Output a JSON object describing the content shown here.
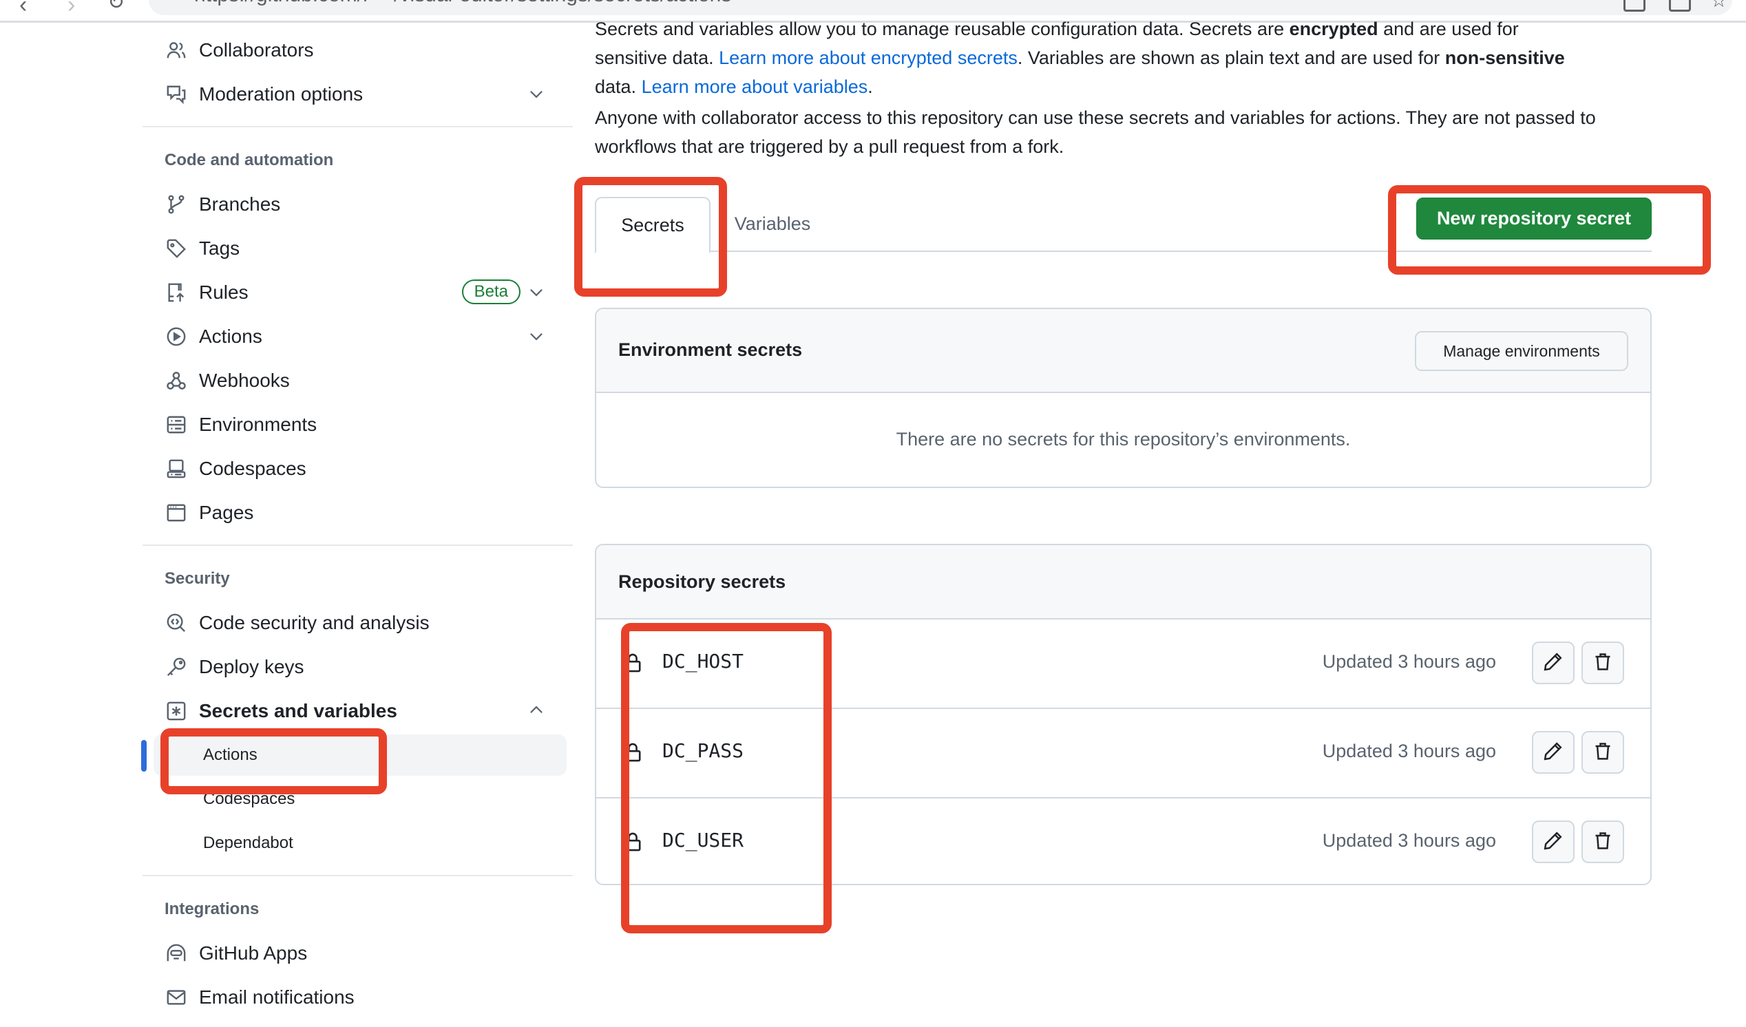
{
  "browser": {
    "url": "https://github.com/r***/visual-editor/settings/secrets/actions"
  },
  "sidebar": {
    "top_items": [
      {
        "label": "Collaborators",
        "icon": "people-icon"
      },
      {
        "label": "Moderation options",
        "icon": "comment-discussion-icon",
        "expandable": true
      }
    ],
    "sections": [
      {
        "heading": "Code and automation",
        "items": [
          {
            "label": "Branches",
            "icon": "git-branch-icon"
          },
          {
            "label": "Tags",
            "icon": "tag-icon"
          },
          {
            "label": "Rules",
            "icon": "repo-push-icon",
            "badge": "Beta",
            "expandable": true
          },
          {
            "label": "Actions",
            "icon": "play-icon",
            "expandable": true
          },
          {
            "label": "Webhooks",
            "icon": "webhook-icon"
          },
          {
            "label": "Environments",
            "icon": "server-icon"
          },
          {
            "label": "Codespaces",
            "icon": "codespaces-icon"
          },
          {
            "label": "Pages",
            "icon": "browser-icon"
          }
        ]
      },
      {
        "heading": "Security",
        "items": [
          {
            "label": "Code security and analysis",
            "icon": "codescan-icon"
          },
          {
            "label": "Deploy keys",
            "icon": "key-icon"
          },
          {
            "label": "Secrets and variables",
            "icon": "key-asterisk-icon",
            "expanded": true,
            "subitems": [
              {
                "label": "Actions",
                "active": true
              },
              {
                "label": "Codespaces"
              },
              {
                "label": "Dependabot"
              }
            ]
          }
        ]
      },
      {
        "heading": "Integrations",
        "items": [
          {
            "label": "GitHub Apps",
            "icon": "hubot-icon"
          },
          {
            "label": "Email notifications",
            "icon": "mail-icon"
          }
        ]
      }
    ]
  },
  "main": {
    "intro_line1": "Secrets and variables allow you to manage reusable configuration data. Secrets are ",
    "intro_bold1": "encrypted",
    "intro_line1_end": " and are used for",
    "intro_line2_start": "sensitive data. ",
    "link_encrypted_secrets": "Learn more about encrypted secrets",
    "intro_line2_mid": ". Variables are shown as plain text and are used for ",
    "intro_bold2": "non-sensitive",
    "intro_line3_start": "data. ",
    "link_variables": "Learn more about variables",
    "intro_line3_end": ".",
    "access_note": "Anyone with collaborator access to this repository can use these secrets and variables for actions. They are not passed to workflows that are triggered by a pull request from a fork.",
    "tabs": [
      {
        "label": "Secrets",
        "selected": true
      },
      {
        "label": "Variables",
        "selected": false
      }
    ],
    "new_secret_button": "New repository secret",
    "environment_secrets": {
      "title": "Environment secrets",
      "manage_button": "Manage environments",
      "empty_message": "There are no secrets for this repository’s environments."
    },
    "repository_secrets": {
      "title": "Repository secrets",
      "rows": [
        {
          "name": "DC_HOST",
          "updated": "Updated 3 hours ago"
        },
        {
          "name": "DC_PASS",
          "updated": "Updated 3 hours ago"
        },
        {
          "name": "DC_USER",
          "updated": "Updated 3 hours ago"
        }
      ]
    }
  },
  "colors": {
    "primary_button": "#1f883d",
    "link": "#0969da",
    "beta_badge": "#1a7f37",
    "annotation": "#e8412a",
    "active_indicator": "#2f6bdb"
  }
}
